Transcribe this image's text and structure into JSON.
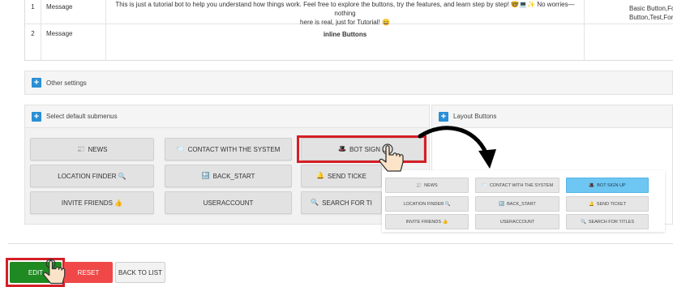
{
  "table": {
    "rows": [
      {
        "num": "1",
        "type": "Message",
        "text_line1": "This is just a tutorial bot to help you understand how things work. Feel free to explore the buttons, try the features, and learn step by step! 🤓💻✨ No worries—nothing",
        "text_line2": "here is real, just for Tutorial! 😄",
        "buttons_line1": "Basic Button,Form-mak",
        "buttons_line2": "Button,Test,Form_"
      },
      {
        "num": "2",
        "type": "Message",
        "text_line1": "inline Buttons",
        "text_line2": "",
        "buttons_line1": "",
        "buttons_line2": ""
      }
    ]
  },
  "panels": {
    "other_settings": "Other settings",
    "select_submenus": "Select default submenus",
    "layout_buttons": "Layout Buttons"
  },
  "submenu_buttons": [
    {
      "label": "NEWS",
      "icon": "📰"
    },
    {
      "label": "CONTACT WITH THE SYSTEM",
      "icon": "📨"
    },
    {
      "label": "BOT SIGN U",
      "icon": "🎩"
    },
    {
      "label": "LOCATION FINDER 🔍",
      "icon": ""
    },
    {
      "label": "BACK_START",
      "icon": "🔙"
    },
    {
      "label": "SEND TICKE",
      "icon": "🔔"
    },
    {
      "label": "INVITE FRIENDS 👍",
      "icon": ""
    },
    {
      "label": "USERACCOUNT",
      "icon": ""
    },
    {
      "label": "SEARCH FOR TI",
      "icon": "🔍"
    }
  ],
  "layout_preview": [
    {
      "label": "NEWS",
      "icon": "📰"
    },
    {
      "label": "CONTACT WITH THE SYSTEM",
      "icon": "📨"
    },
    {
      "label": "BOT SIGN UP",
      "icon": "🎩"
    },
    {
      "label": "LOCATION FINDER 🔍",
      "icon": ""
    },
    {
      "label": "BACK_START",
      "icon": "🔙"
    },
    {
      "label": "SEND TICKET",
      "icon": "🔔"
    },
    {
      "label": "INVITE FRIENDS 👍",
      "icon": ""
    },
    {
      "label": "USERACCOUNT",
      "icon": ""
    },
    {
      "label": "SEARCH FOR TITLES",
      "icon": "🔍"
    }
  ],
  "actions": {
    "edit": "EDIT",
    "reset": "RESET",
    "back": "BACK TO LIST"
  },
  "colors": {
    "accent_blue": "#2a8fd6",
    "edit_green": "#1f8a22",
    "reset_red": "#f04848",
    "highlight_red": "#d51f26",
    "active_blue": "#6ec6f2"
  }
}
